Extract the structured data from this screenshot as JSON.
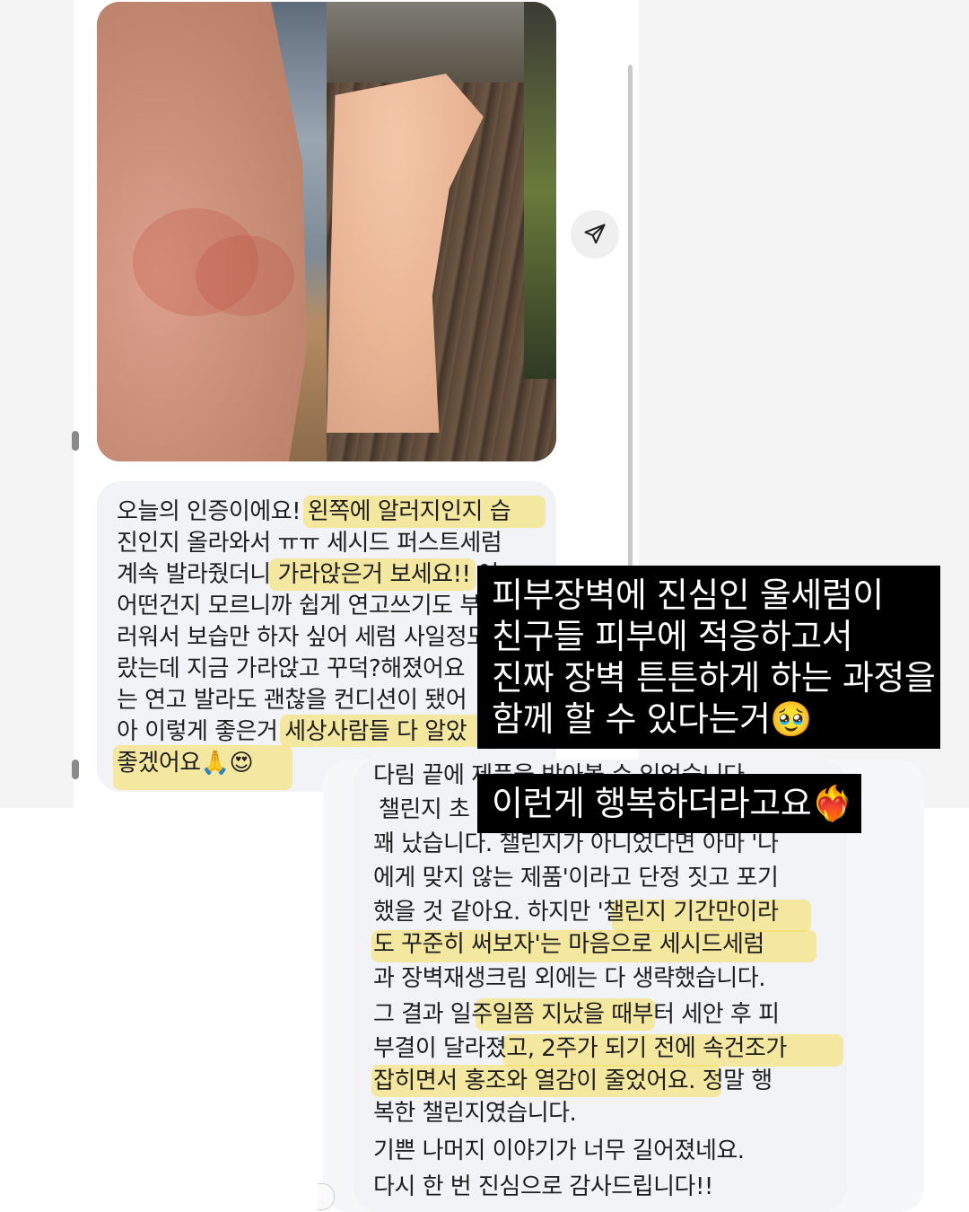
{
  "message1": {
    "lines": [
      "오늘의 인증이에요! 왼쪽에 알러지인지 습",
      "진인지 올라와서 ㅠㅠ 세시드 퍼스트세럼",
      "계속 발라줬더니 가라앉은거 보세요!! 어",
      "어떤건지 모르니까 쉽게 연고쓰기도 부",
      "러워서 보습만 하자 싶어 세럼 사일정도",
      "랐는데 지금 가라앉고 꾸덕?해졌어요",
      "는 연고 발라도 괜찮을 컨디션이 됐어",
      "아 이렇게 좋은거 세상사람들 다 알았",
      "좋겠어요🙏😍"
    ]
  },
  "message2": {
    "lines": [
      "다림 끝에 제품을 받아볼 수 있었습니다.",
      "챌린지 초",
      "꽤 났습니다. 챌린지가 아니었다면 아마 '나",
      "에게 맞지 않는 제품'이라고 단정 짓고 포기",
      "했을 것 같아요. 하지만 '챌린지 기간만이라",
      "도 꾸준히 써보자'는 마음으로 세시드세럼",
      "과 장벽재생크림 외에는 다 생략했습니다.",
      "그 결과 일주일쯤 지났을 때부터 세안 후 피",
      "부결이 달라졌고, 2주가 되기 전에 속건조가",
      "잡히면서 홍조와 열감이 줄었어요. 정말 행",
      "복한 챌린지였습니다.",
      "기쁜 나머지 이야기가 너무 길어졌네요.",
      "다시 한 번 진심으로 감사드립니다!!"
    ]
  },
  "overlay1": {
    "lines": [
      "피부장벽에 진심인 울세럼이",
      "친구들 피부에 적응하고서",
      "진짜 장벽 튼튼하게 하는 과정을",
      "함께 할 수 있다는거🥹"
    ]
  },
  "overlay2": {
    "text": "이런게 행복하더라고요❤️‍🔥"
  },
  "colors": {
    "bubble": "#f1f3f6",
    "highlight": "#f5dc5a",
    "overlay_bg": "#000000",
    "overlay_text": "#ffffff"
  },
  "icons": {
    "share": "paper-plane-icon"
  }
}
